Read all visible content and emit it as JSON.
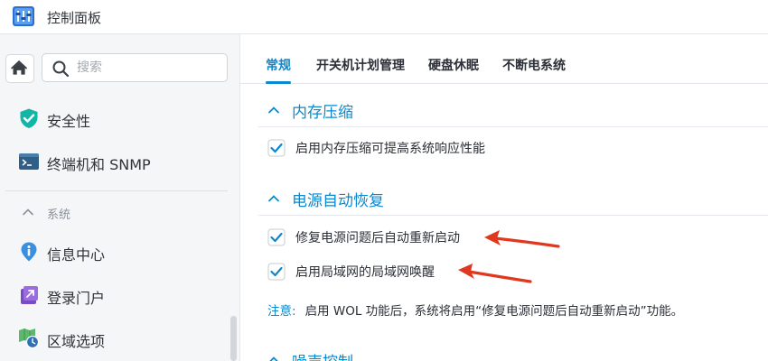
{
  "window": {
    "title": "控制面板"
  },
  "sidebar": {
    "search_placeholder": "搜索",
    "items_top": [
      {
        "label": "安全性",
        "icon": "shield-check-icon"
      },
      {
        "label": "终端机和 SNMP",
        "icon": "terminal-icon"
      }
    ],
    "group_label": "系统",
    "items_system": [
      {
        "label": "信息中心",
        "icon": "info-icon"
      },
      {
        "label": "登录门户",
        "icon": "login-portal-icon"
      },
      {
        "label": "区域选项",
        "icon": "region-clock-icon"
      }
    ]
  },
  "tabs": [
    {
      "label": "常规",
      "active": true
    },
    {
      "label": "开关机计划管理",
      "active": false
    },
    {
      "label": "硬盘休眠",
      "active": false
    },
    {
      "label": "不断电系统",
      "active": false
    }
  ],
  "sections": [
    {
      "label": "内存压缩",
      "options": [
        {
          "label": "启用内存压缩可提高系统响应性能",
          "checked": true
        }
      ]
    },
    {
      "label": "电源自动恢复",
      "options": [
        {
          "label": "修复电源问题后自动重新启动",
          "checked": true
        },
        {
          "label": "启用局域网的局域网唤醒",
          "checked": true
        }
      ],
      "note_key": "注意:",
      "note_text": "启用 WOL 功能后，系统将启用“修复电源问题后自动重新启动”功能。"
    },
    {
      "label": "噪声控制"
    }
  ],
  "colors": {
    "accent": "#0a89cf",
    "annotation_arrow": "#e0381f",
    "sidebar_bg": "#f4f6f8"
  }
}
